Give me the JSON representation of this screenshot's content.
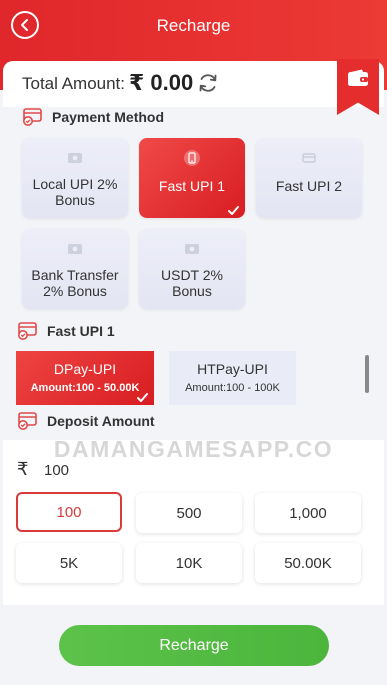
{
  "header": {
    "title": "Recharge"
  },
  "total": {
    "label": "Total Amount:",
    "value": "₹ 0.00"
  },
  "payment_method": {
    "title": "Payment Method",
    "items": [
      {
        "label": "Local UPI 2% Bonus",
        "active": false
      },
      {
        "label": "Fast UPI 1",
        "active": true
      },
      {
        "label": "Fast UPI 2",
        "active": false
      },
      {
        "label": "Bank Transfer 2% Bonus",
        "active": false
      },
      {
        "label": "USDT 2% Bonus",
        "active": false
      }
    ]
  },
  "channel_section": {
    "title": "Fast UPI 1",
    "channels": [
      {
        "name": "DPay-UPI",
        "range": "Amount:100 - 50.00K",
        "active": true
      },
      {
        "name": "HTPay-UPI",
        "range": "Amount:100 - 100K",
        "active": false
      }
    ]
  },
  "deposit": {
    "title": "Deposit Amount",
    "watermark": "DAMANGAMESAPP.CO",
    "currency_symbol": "₹",
    "input_value": "100",
    "amounts": [
      "100",
      "500",
      "1,000",
      "5K",
      "10K",
      "50.00K"
    ],
    "selected_amount": "100"
  },
  "recharge_button": "Recharge",
  "colors": {
    "brand_red": "#e0272b",
    "tile_bg": "#e9ebf6",
    "recharge_green": "#4bb53c"
  },
  "icons": {
    "back": "back-arrow-icon",
    "refresh": "refresh-icon",
    "wallet": "wallet-icon",
    "section": "card-check-icon"
  }
}
